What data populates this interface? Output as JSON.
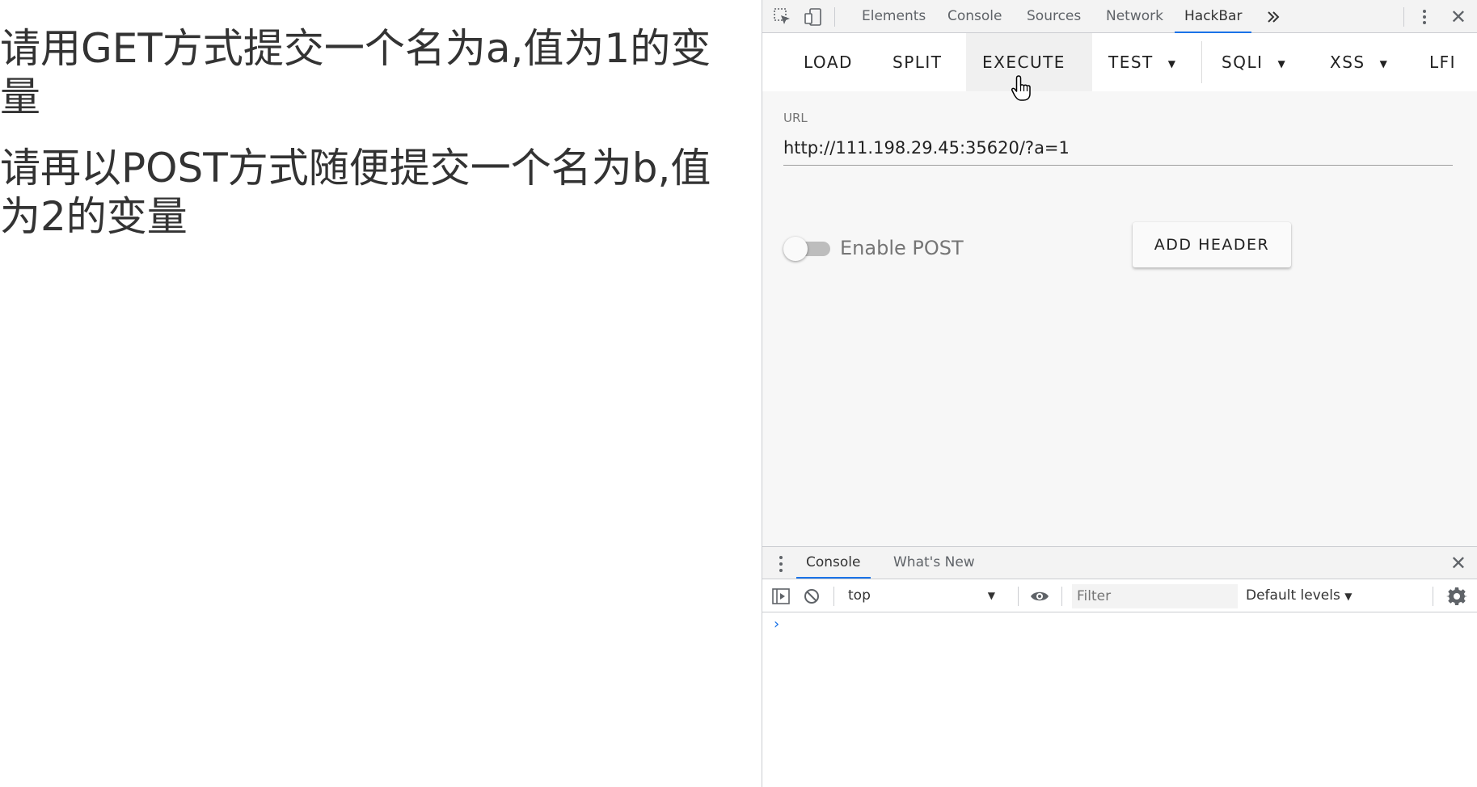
{
  "page": {
    "line1": "请用GET方式提交一个名为a,值为1的变量",
    "line2": "请再以POST方式随便提交一个名为b,值为2的变量"
  },
  "devtools": {
    "tabs": [
      "Elements",
      "Console",
      "Sources",
      "Network",
      "HackBar"
    ],
    "active_tab": "HackBar",
    "more_icon": "double-chevron-right-icon"
  },
  "hackbar": {
    "buttons": {
      "load": "LOAD",
      "split": "SPLIT",
      "execute": "EXECUTE",
      "test": "TEST",
      "sqli": "SQLI",
      "xss": "XSS",
      "lfi": "LFI"
    },
    "url_label": "URL",
    "url_value": "http://111.198.29.45:35620/?a=1",
    "enable_post_label": "Enable POST",
    "enable_post_on": false,
    "add_header_label": "ADD HEADER"
  },
  "drawer": {
    "tabs": [
      "Console",
      "What's New"
    ],
    "active_tab": "Console"
  },
  "console_toolbar": {
    "context": "top",
    "filter_placeholder": "Filter",
    "levels": "Default levels"
  },
  "colors": {
    "accent": "#1a73e8",
    "toolbar_bg": "#f3f3f3",
    "hackbar_bg": "#f7f7f7"
  }
}
